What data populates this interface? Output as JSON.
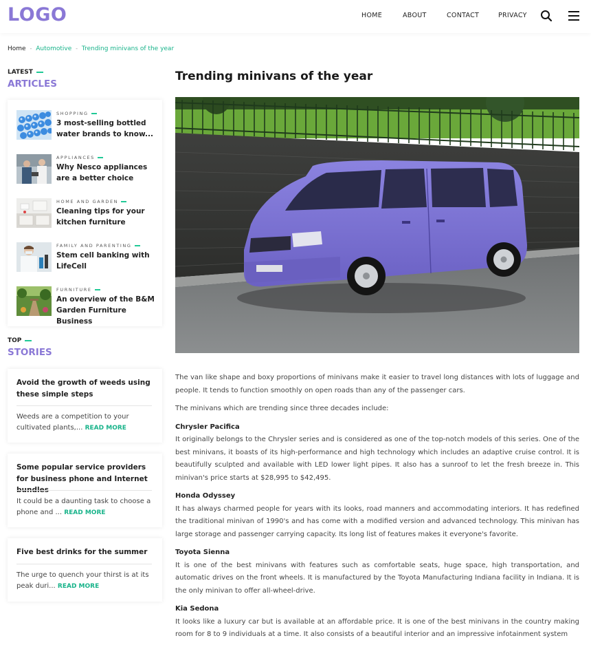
{
  "header": {
    "logo": "LOGO",
    "nav": [
      "HOME",
      "ABOUT",
      "CONTACT",
      "PRIVACY"
    ]
  },
  "breadcrumb": [
    "Home",
    "Automotive",
    "Trending minivans of the year"
  ],
  "sidebar": {
    "latest_kicker": "LATEST",
    "latest_heading": "ARTICLES",
    "articles": [
      {
        "category": "SHOPPING",
        "title": "3 most-selling bottled water brands to know..."
      },
      {
        "category": "APPLIANCES",
        "title": "Why Nesco appliances are a better choice"
      },
      {
        "category": "HOME AND GARDEN",
        "title": "Cleaning tips for your kitchen furniture"
      },
      {
        "category": "FAMILY AND PARENTING",
        "title": "Stem cell banking with LifeCell"
      },
      {
        "category": "FURNITURE",
        "title": "An overview of the B&M Garden Furniture Business"
      }
    ],
    "top_kicker": "TOP",
    "top_heading": "STORIES",
    "stories": [
      {
        "title": "Avoid the growth of weeds using these simple steps",
        "excerpt": "Weeds are a competition to your cultivated plants,...",
        "read_more": "READ MORE"
      },
      {
        "title": "Some popular service providers for business phone and Internet bundles",
        "excerpt": "It could be a daunting task to choose a phone and ...",
        "read_more": "READ MORE"
      },
      {
        "title": "Five best drinks for the summer",
        "excerpt": "The urge to quench your thirst is at its peak duri...",
        "read_more": "READ MORE"
      }
    ]
  },
  "article": {
    "title": "Trending minivans of the year",
    "intro": "The van like shape and boxy proportions of minivans make it easier to travel long distances with lots of luggage and people. It tends to function smoothly on open roads than any of the passenger cars.",
    "lead": "The minivans which are trending since three decades include:",
    "sections": [
      {
        "heading": "Chrysler Pacifica",
        "text": "It originally belongs to the Chrysler series and is considered as one of the top-notch models of this series. One of the best minivans, it boasts of its high-performance and high technology which includes an adaptive cruise control. It is beautifully sculpted and available with LED lower light pipes. It also has a sunroof to let the fresh breeze in. This minivan's price starts at $28,995 to $42,495."
      },
      {
        "heading": "Honda Odyssey",
        "text": "It has always charmed people for years with its looks, road manners and accommodating interiors. It has redefined the traditional minivan of 1990's and has come with a modified version and advanced technology. This minivan has large storage and passenger carrying capacity. Its long list of features makes it everyone's favorite."
      },
      {
        "heading": "Toyota Sienna",
        "text": "It is one of the best minivans with features such as comfortable seats, huge space, high transportation, and automatic drives on the front wheels. It is manufactured by the Toyota Manufacturing Indiana facility in Indiana. It is the only minivan to offer all-wheel-drive."
      },
      {
        "heading": "Kia Sedona",
        "text": "It looks like a luxury car but is available at an affordable price. It is one of the best minivans in the country making room for 8 to 9 individuals at a time. It also consists of a beautiful interior and an impressive infotainment system"
      }
    ]
  },
  "colors": {
    "brand": "#8a78d6",
    "accent": "#20c996",
    "link": "#18b38a"
  }
}
